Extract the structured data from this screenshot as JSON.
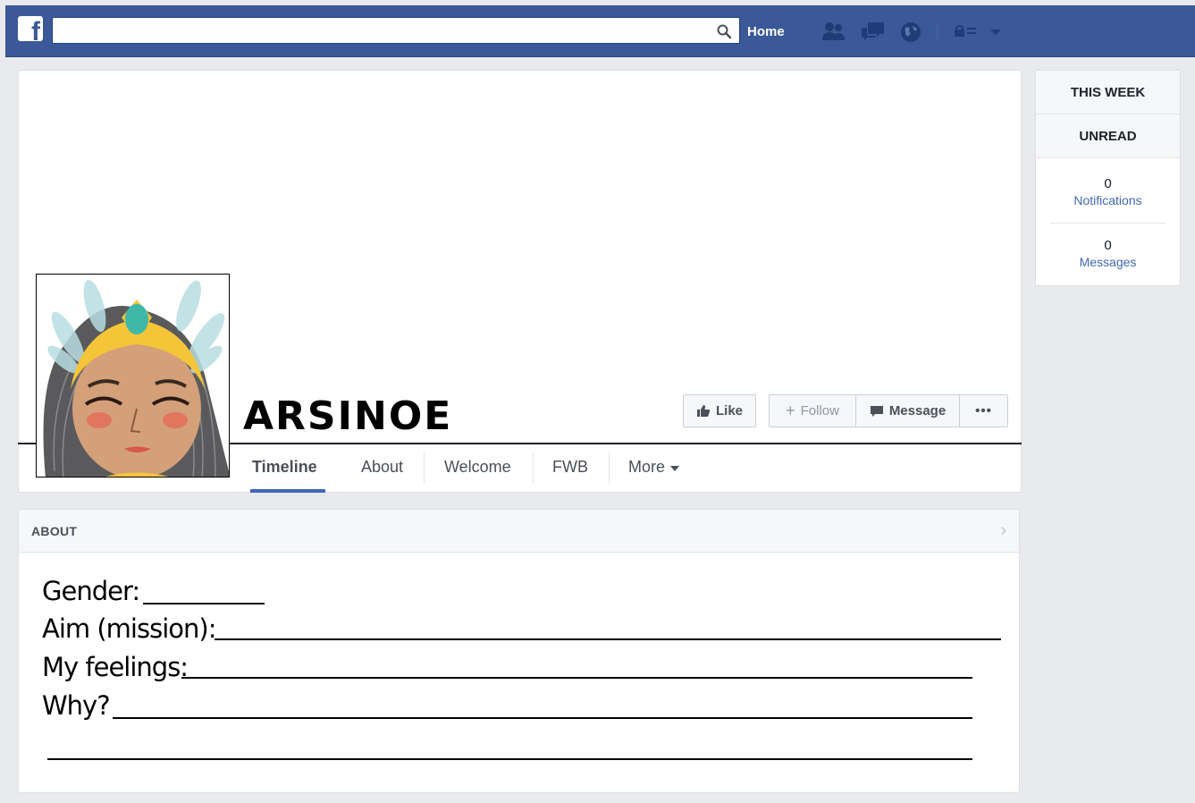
{
  "nav": {
    "search_placeholder": "",
    "home_label": "Home"
  },
  "profile": {
    "name": "ARSINOE"
  },
  "actions": {
    "like": "Like",
    "follow": "Follow",
    "message": "Message",
    "more": "•••"
  },
  "tabs": [
    {
      "label": "Timeline"
    },
    {
      "label": "About"
    },
    {
      "label": "Welcome"
    },
    {
      "label": "FWB"
    },
    {
      "label": "More"
    }
  ],
  "about": {
    "title": "ABOUT",
    "fields": [
      {
        "label": "Gender:"
      },
      {
        "label": "Aim (mission):"
      },
      {
        "label": "My feelings:"
      },
      {
        "label": "Why?"
      }
    ]
  },
  "sidebar": {
    "this_week": "THIS WEEK",
    "unread": "UNREAD",
    "notifications_count": "0",
    "notifications_label": "Notifications",
    "messages_count": "0",
    "messages_label": "Messages"
  },
  "colors": {
    "brand": "#3b5998",
    "link": "#4267b2"
  }
}
